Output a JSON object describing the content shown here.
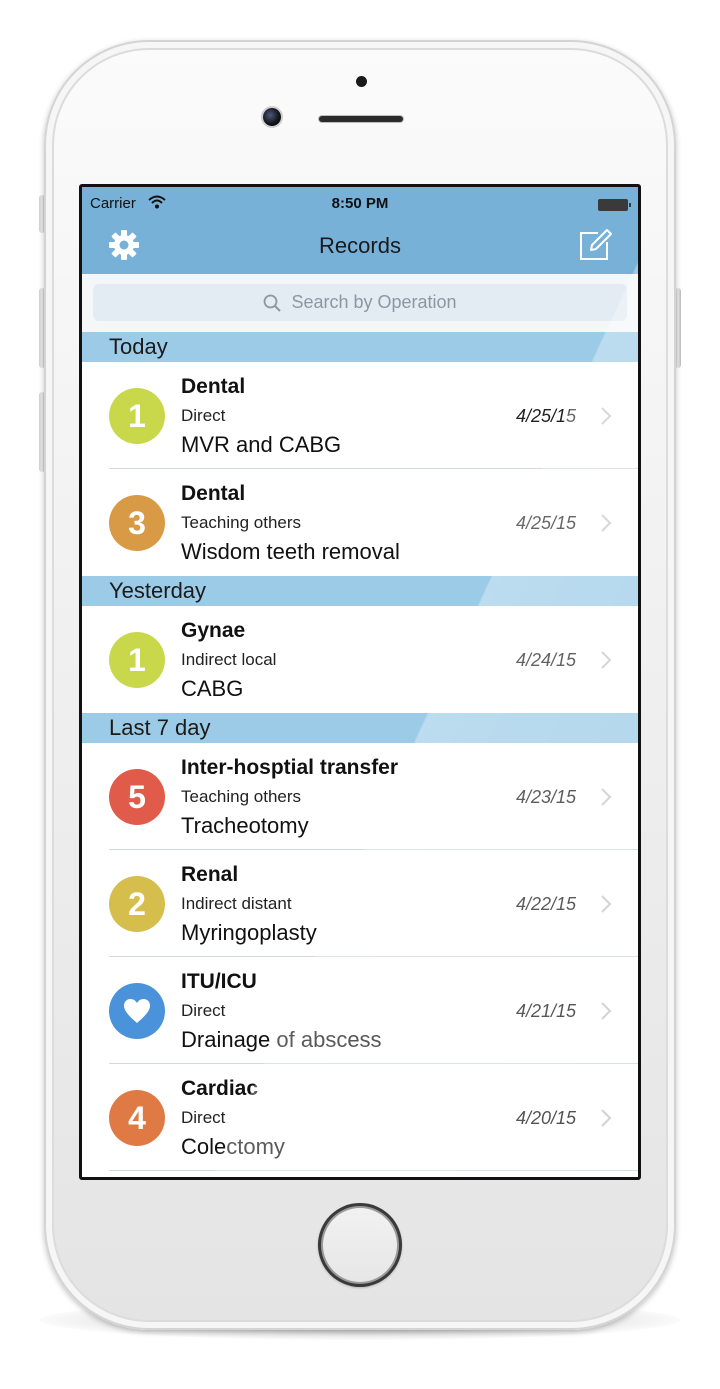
{
  "status_bar": {
    "carrier": "Carrier",
    "time": "8:50 PM"
  },
  "nav": {
    "title": "Records",
    "left_icon": "gear-icon",
    "right_icon": "compose-icon"
  },
  "search": {
    "placeholder": "Search by Operation"
  },
  "colors": {
    "nav_bg": "#77b1d8",
    "section_bg": "#9ccbe7",
    "lime": "#c9d84a",
    "amber": "#d99a45",
    "red": "#e05b4a",
    "mustard": "#d6be4c",
    "blue": "#4a92d9",
    "orange": "#e07a45"
  },
  "sections": [
    {
      "title": "Today",
      "records": [
        {
          "badge": "1",
          "color": "lime",
          "specialty": "Dental",
          "role": "Direct",
          "operation": "MVR and CABG",
          "date": "4/25/15"
        },
        {
          "badge": "3",
          "color": "amber",
          "specialty": "Dental",
          "role": "Teaching others",
          "operation": "Wisdom teeth removal",
          "date": "4/25/15"
        }
      ]
    },
    {
      "title": "Yesterday",
      "records": [
        {
          "badge": "1",
          "color": "lime",
          "specialty": "Gynae",
          "role": "Indirect local",
          "operation": "CABG",
          "date": "4/24/15"
        }
      ]
    },
    {
      "title": "Last 7 day",
      "records": [
        {
          "badge": "5",
          "color": "red",
          "specialty": "Inter-hosptial transfer",
          "role": "Teaching others",
          "operation": "Tracheotomy",
          "date": "4/23/15"
        },
        {
          "badge": "2",
          "color": "mustard",
          "specialty": "Renal",
          "role": "Indirect distant",
          "operation": "Myringoplasty",
          "date": "4/22/15"
        },
        {
          "badge": "",
          "badge_icon": "heart-icon",
          "color": "blue",
          "specialty": "ITU/ICU",
          "role": "Direct",
          "operation": "Drainage of abscess",
          "date": "4/21/15"
        },
        {
          "badge": "4",
          "color": "orange",
          "specialty": "Cardiac",
          "role": "Direct",
          "operation": "Colectomy",
          "date": "4/20/15"
        }
      ]
    }
  ]
}
